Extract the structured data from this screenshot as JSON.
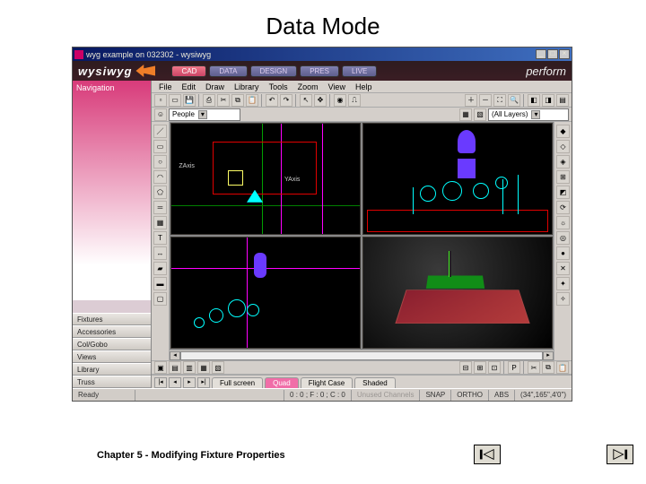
{
  "slide": {
    "title": "Data Mode",
    "chapter": "Chapter 5 - Modifying Fixture Properties"
  },
  "window": {
    "title": "wyg example on 032302 - wysiwyg",
    "min": "_",
    "max": "□",
    "close": "×"
  },
  "brand": {
    "left": "wysiwyg",
    "right": "perform"
  },
  "modeTabs": [
    {
      "label": "CAD",
      "active": true
    },
    {
      "label": "DATA",
      "active": false
    },
    {
      "label": "DESIGN",
      "active": false
    },
    {
      "label": "PRES",
      "active": false
    },
    {
      "label": "LIVE",
      "active": false
    }
  ],
  "navigation": {
    "heading": "Navigation",
    "items": [
      "Fixtures",
      "Accessories",
      "Col/Gobo",
      "Views",
      "Library",
      "Truss"
    ]
  },
  "menubar": [
    "File",
    "Edit",
    "Draw",
    "Library",
    "Tools",
    "Zoom",
    "View",
    "Help"
  ],
  "dropdowns": {
    "category": "People",
    "layers": "(All Layers)"
  },
  "axisLabels": {
    "z": "ZAxis",
    "y": "YAxis"
  },
  "bottomToolbar": {
    "icons": [
      "i1",
      "i2",
      "i3",
      "i4",
      "i5",
      "i6",
      "i7",
      "i8"
    ],
    "right": [
      "L",
      "L",
      "P"
    ]
  },
  "viewTabs": [
    {
      "label": "Full screen",
      "active": false
    },
    {
      "label": "Quad",
      "active": true
    },
    {
      "label": "Flight Case",
      "active": false
    },
    {
      "label": "Shaded",
      "active": false
    }
  ],
  "status": {
    "left": "Ready",
    "coords": "0 : 0 ; F : 0 ; C : 0",
    "unused": "Unused Channels",
    "snap": "SNAP",
    "ortho": "ORTHO",
    "abs": "ABS",
    "pos": "(34\",165\",4'0\")"
  },
  "slideNav": {
    "prev": "◀",
    "next": "▶"
  }
}
